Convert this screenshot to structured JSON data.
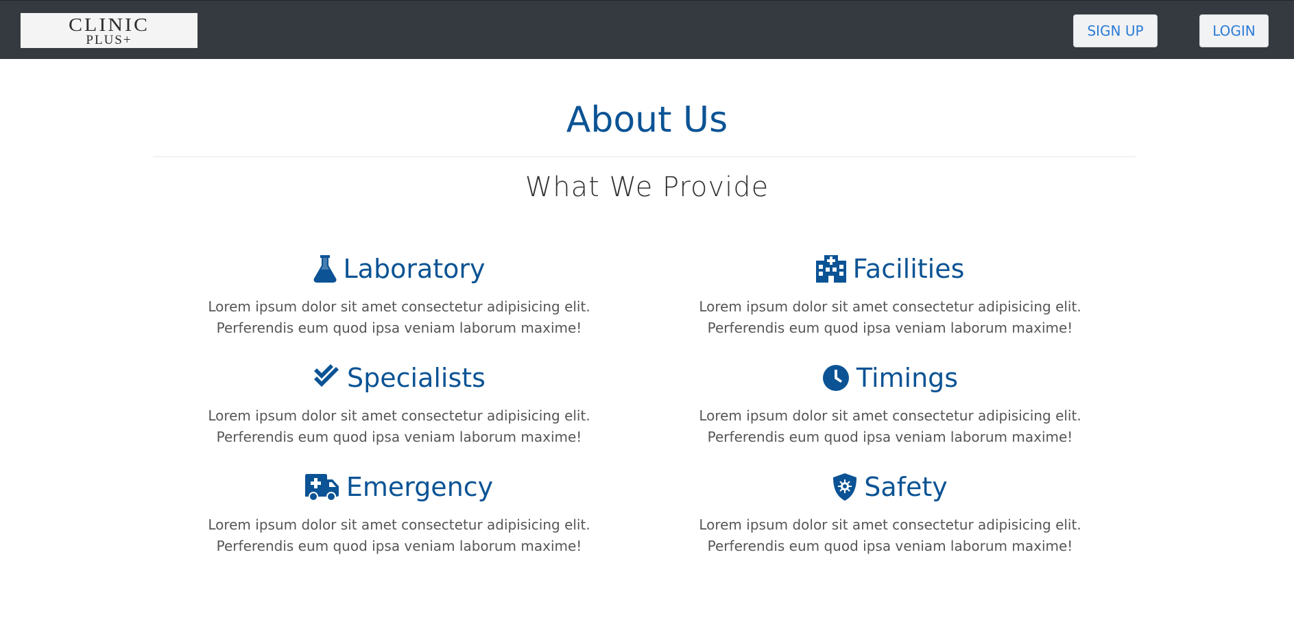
{
  "nav": {
    "logo_line1": "CLINIC",
    "logo_line2": "PLUS+",
    "signup_label": "SIGN UP",
    "login_label": "LOGIN"
  },
  "main": {
    "title": "About Us",
    "subtitle": "What We Provide",
    "features": [
      {
        "icon": "flask-icon",
        "title": "Laboratory",
        "line1": "Lorem ipsum dolor sit amet consectetur adipisicing elit.",
        "line2": "Perferendis eum quod ipsa veniam laborum maxime!"
      },
      {
        "icon": "hospital-icon",
        "title": "Facilities",
        "line1": "Lorem ipsum dolor sit amet consectetur adipisicing elit.",
        "line2": "Perferendis eum quod ipsa veniam laborum maxime!"
      },
      {
        "icon": "double-check-icon",
        "title": "Specialists",
        "line1": "Lorem ipsum dolor sit amet consectetur adipisicing elit.",
        "line2": "Perferendis eum quod ipsa veniam laborum maxime!"
      },
      {
        "icon": "clock-icon",
        "title": "Timings",
        "line1": "Lorem ipsum dolor sit amet consectetur adipisicing elit.",
        "line2": "Perferendis eum quod ipsa veniam laborum maxime!"
      },
      {
        "icon": "ambulance-icon",
        "title": "Emergency",
        "line1": "Lorem ipsum dolor sit amet consectetur adipisicing elit.",
        "line2": "Perferendis eum quod ipsa veniam laborum maxime!"
      },
      {
        "icon": "shield-virus-icon",
        "title": "Safety",
        "line1": "Lorem ipsum dolor sit amet consectetur adipisicing elit.",
        "line2": "Perferendis eum quod ipsa veniam laborum maxime!"
      }
    ]
  },
  "colors": {
    "navbar_bg": "#343a40",
    "accent_blue": "#0b5394",
    "button_text": "#2b7bd6"
  }
}
